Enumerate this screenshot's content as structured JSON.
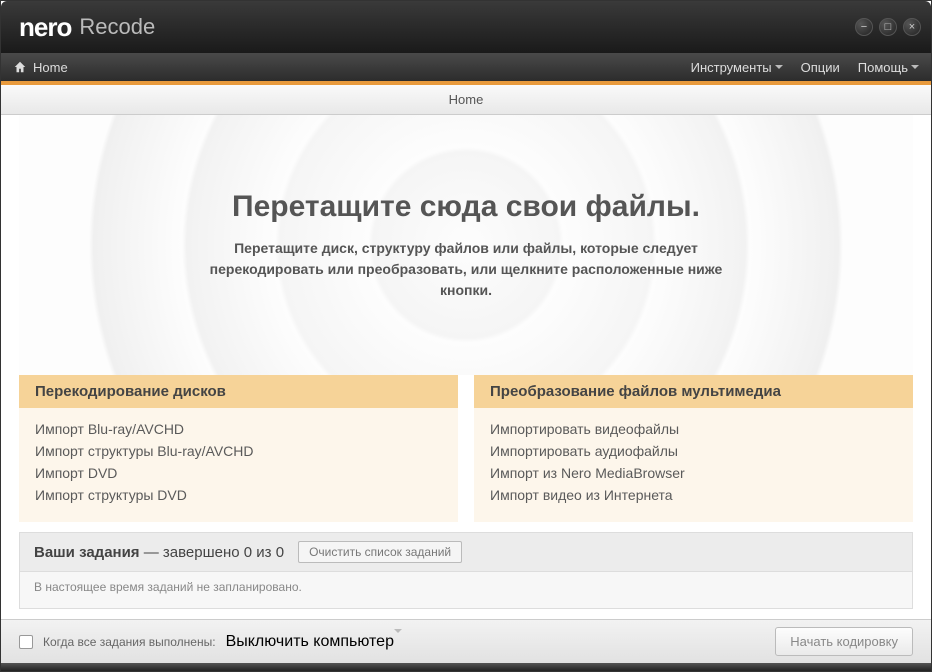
{
  "title": {
    "brand": "nero",
    "product": "Recode"
  },
  "menubar": {
    "home": "Home",
    "items": [
      "Инструменты",
      "Опции",
      "Помощь"
    ]
  },
  "breadcrumb": "Home",
  "dropzone": {
    "heading": "Перетащите сюда свои файлы.",
    "sub": "Перетащите диск, структуру файлов или файлы, которые следует перекодировать или преобразовать, или щелкните расположенные ниже кнопки."
  },
  "columns": {
    "left": {
      "title": "Перекодирование дисков",
      "links": [
        "Импорт Blu-ray/AVCHD",
        "Импорт структуры Blu-ray/AVCHD",
        "Импорт DVD",
        "Импорт структуры DVD"
      ]
    },
    "right": {
      "title": "Преобразование файлов мультимедиа",
      "links": [
        "Импортировать видеофайлы",
        "Импортировать аудиофайлы",
        "Импорт из Nero MediaBrowser",
        "Импорт видео из Интернета"
      ]
    }
  },
  "jobs": {
    "label_bold": "Ваши задания",
    "label_rest": " — завершено 0 из 0",
    "clear_btn": "Очистить список заданий",
    "empty_msg": "В настоящее время заданий не запланировано."
  },
  "footer": {
    "when_done_label": "Когда все задания выполнены:",
    "action_selected": "Выключить компьютер",
    "start_btn": "Начать кодировку"
  }
}
